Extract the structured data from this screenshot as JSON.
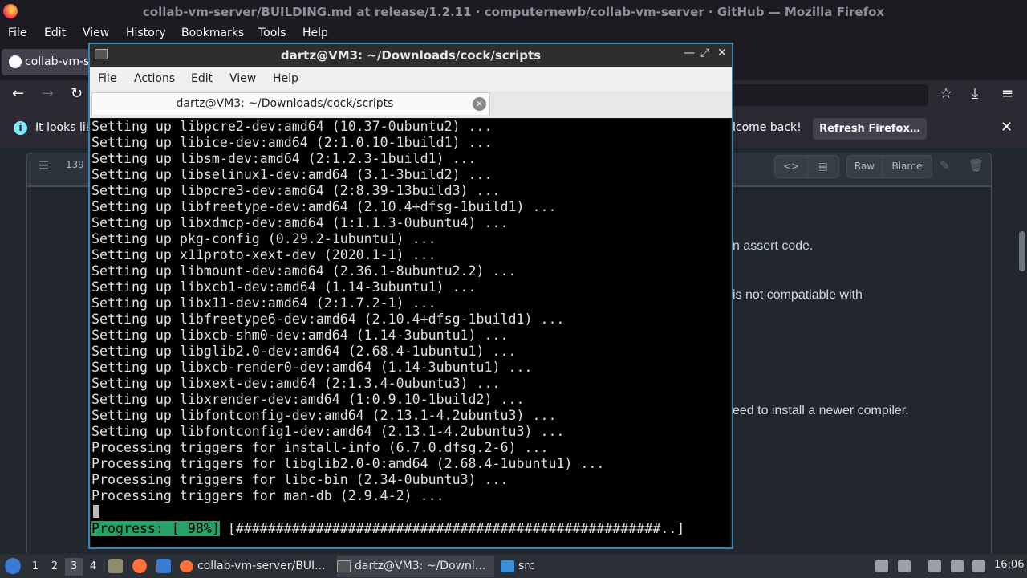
{
  "firefox": {
    "title": "collab-vm-server/BUILDING.md at release/1.2.11 · computernewb/collab-vm-server · GitHub — Mozilla Firefox",
    "menu": [
      "File",
      "Edit",
      "View",
      "History",
      "Bookmarks",
      "Tools",
      "Help"
    ],
    "tab_title": "collab-vm-se",
    "infobar": {
      "text_left": "It looks lik",
      "text_right": "lcome back!",
      "refresh_button": "Refresh Firefox…"
    },
    "github": {
      "line_count": "139",
      "raw_label": "Raw",
      "blame_label": "Blame",
      "content_fragments": [
        "n assert code.",
        "is not compatiable with",
        "eed to install a newer compiler."
      ]
    }
  },
  "terminal": {
    "window_title": "dartz@VM3: ~/Downloads/cock/scripts",
    "menu": [
      "File",
      "Actions",
      "Edit",
      "View",
      "Help"
    ],
    "tab_title": "dartz@VM3: ~/Downloads/cock/scripts",
    "lines": [
      "Setting up libpcre2-dev:amd64 (10.37-0ubuntu2) ...",
      "Setting up libice-dev:amd64 (2:1.0.10-1build1) ...",
      "Setting up libsm-dev:amd64 (2:1.2.3-1build1) ...",
      "Setting up libselinux1-dev:amd64 (3.1-3build2) ...",
      "Setting up libpcre3-dev:amd64 (2:8.39-13build3) ...",
      "Setting up libfreetype-dev:amd64 (2.10.4+dfsg-1build1) ...",
      "Setting up libxdmcp-dev:amd64 (1:1.1.3-0ubuntu4) ...",
      "Setting up pkg-config (0.29.2-1ubuntu1) ...",
      "Setting up x11proto-xext-dev (2020.1-1) ...",
      "Setting up libmount-dev:amd64 (2.36.1-8ubuntu2.2) ...",
      "Setting up libxcb1-dev:amd64 (1.14-3ubuntu1) ...",
      "Setting up libx11-dev:amd64 (2:1.7.2-1) ...",
      "Setting up libfreetype6-dev:amd64 (2.10.4+dfsg-1build1) ...",
      "Setting up libxcb-shm0-dev:amd64 (1.14-3ubuntu1) ...",
      "Setting up libglib2.0-dev:amd64 (2.68.4-1ubuntu1) ...",
      "Setting up libxcb-render0-dev:amd64 (1.14-3ubuntu1) ...",
      "Setting up libxext-dev:amd64 (2:1.3.4-0ubuntu3) ...",
      "Setting up libxrender-dev:amd64 (1:0.9.10-1build2) ...",
      "Setting up libfontconfig-dev:amd64 (2.13.1-4.2ubuntu3) ...",
      "Setting up libfontconfig1-dev:amd64 (2.13.1-4.2ubuntu3) ...",
      "Processing triggers for install-info (6.7.0.dfsg.2-6) ...",
      "Processing triggers for libglib2.0-0:amd64 (2.68.4-1ubuntu1) ...",
      "Processing triggers for libc-bin (2.34-0ubuntu3) ...",
      "Processing triggers for man-db (2.9.4-2) ..."
    ],
    "progress": {
      "label": "Progress: [ 98%]",
      "bar": " [#####################################################..]",
      "percent": 98
    }
  },
  "taskbar": {
    "workspaces": [
      "1",
      "2",
      "3",
      "4"
    ],
    "active_workspace": "3",
    "tasks": [
      {
        "label": "collab-vm-server/BUI...",
        "icon": "firefox-icon"
      },
      {
        "label": "dartz@VM3: ~/Downl...",
        "icon": "terminal-icon"
      },
      {
        "label": "src",
        "icon": "folder-icon"
      }
    ],
    "clock": "16:06"
  },
  "colors": {
    "progress_green": "#26a269",
    "terminal_bg": "#000000",
    "window_border": "#3c7fb1"
  }
}
